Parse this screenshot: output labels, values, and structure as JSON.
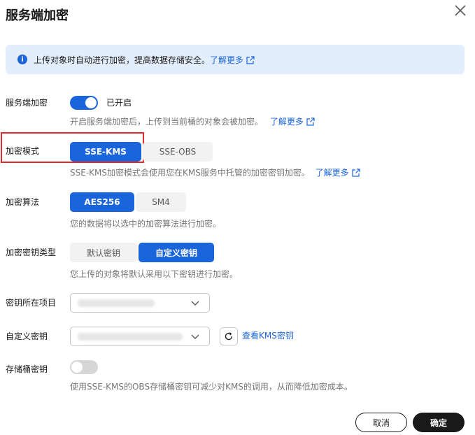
{
  "dialog": {
    "title": "服务端加密"
  },
  "banner": {
    "text": "上传对象时自动进行加密，提高数据存储安全。",
    "link": "了解更多"
  },
  "sse": {
    "label": "服务端加密",
    "state_text": "已开启",
    "enabled": true,
    "desc": "开启服务端加密后，上传到当前桶的对象会被加密。",
    "link": "了解更多"
  },
  "mode": {
    "label": "加密模式",
    "options": [
      "SSE-KMS",
      "SSE-OBS"
    ],
    "selected": "SSE-KMS",
    "desc": "SSE-KMS加密模式会使用您在KMS服务中托管的加密密钥加密。",
    "link": "了解更多"
  },
  "algorithm": {
    "label": "加密算法",
    "options": [
      "AES256",
      "SM4"
    ],
    "selected": "AES256",
    "desc": "您的数据将以选中的加密算法进行加密。"
  },
  "key_type": {
    "label": "加密密钥类型",
    "options": [
      "默认密钥",
      "自定义密钥"
    ],
    "selected": "自定义密钥",
    "desc": "您上传的对象将默认采用以下密钥进行加密。"
  },
  "key_project": {
    "label": "密钥所在项目"
  },
  "custom_key": {
    "label": "自定义密钥",
    "link": "查看KMS密钥"
  },
  "bucket_key": {
    "label": "存储桶密钥",
    "enabled": false,
    "desc": "使用SSE-KMS的OBS存储桶密钥可减少对KMS的调用，从而降低加密成本。"
  },
  "footer": {
    "cancel": "取消",
    "ok": "确定"
  },
  "colors": {
    "primary": "#1a64dc",
    "highlight": "#e02c2c",
    "banner_bg": "#e3eefc"
  }
}
